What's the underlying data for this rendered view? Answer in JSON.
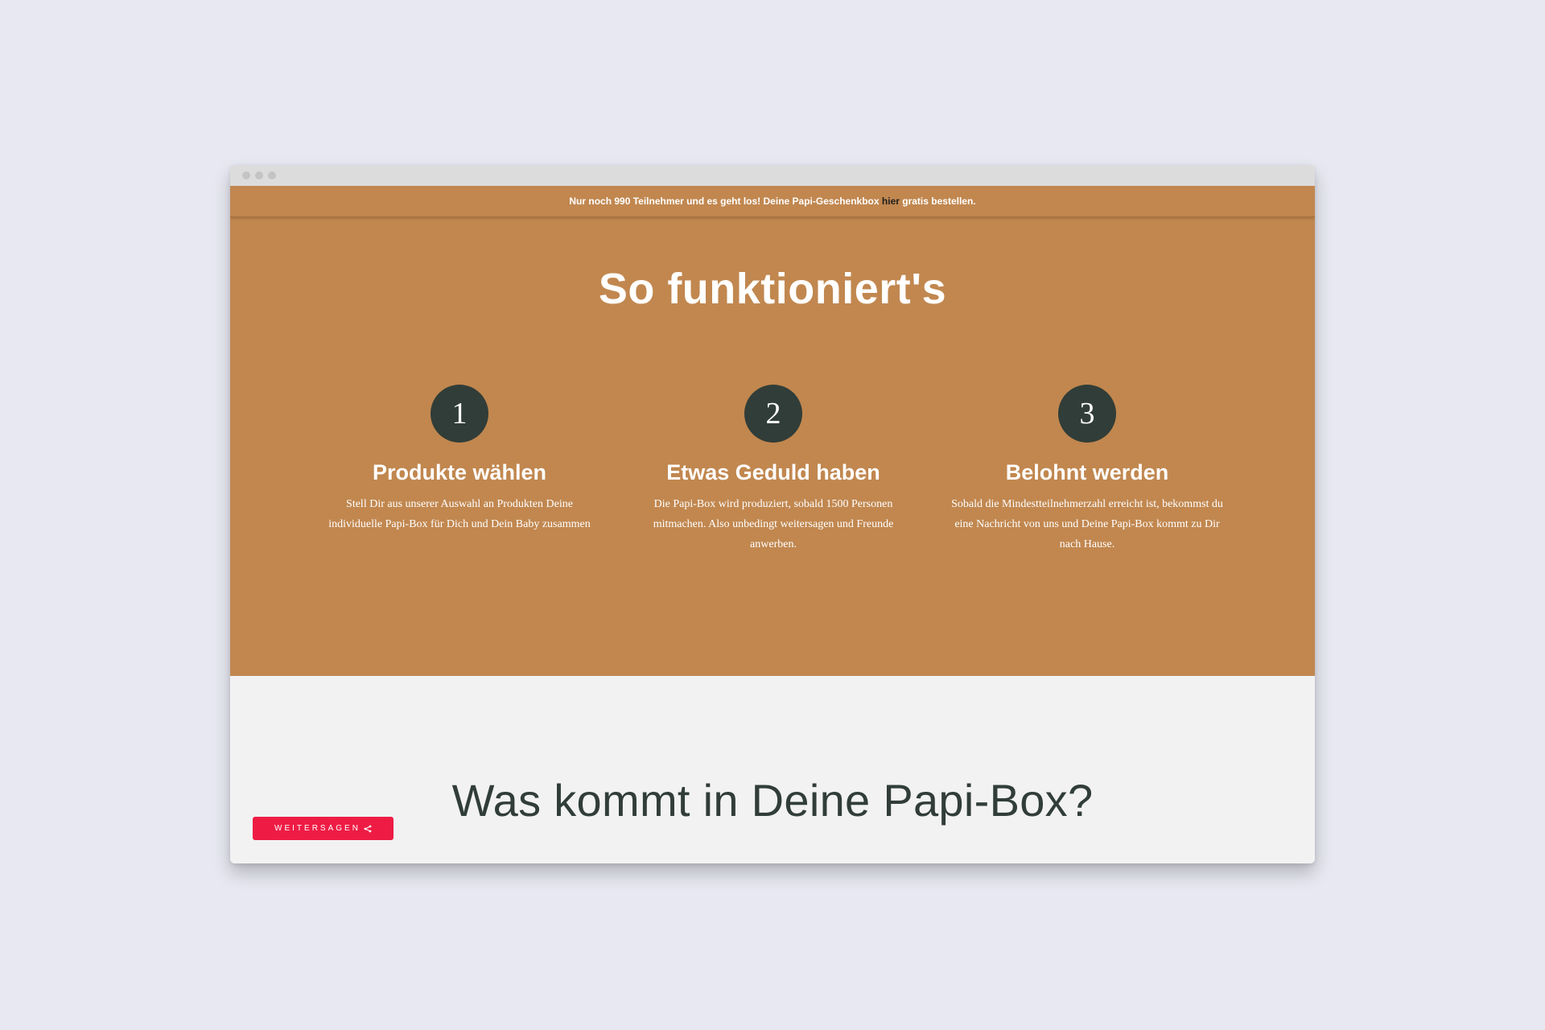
{
  "announcement": {
    "before": "Nur noch 990 Teilnehmer und es geht los! Deine Papi-Geschenkbox ",
    "link": "hier",
    "after": " gratis bestellen."
  },
  "how": {
    "title": "So funktioniert's",
    "steps": [
      {
        "number": "1",
        "title": "Produkte wählen",
        "text": "Stell Dir aus unserer Auswahl an Produkten Deine individuelle Papi-Box für Dich und Dein Baby zusammen"
      },
      {
        "number": "2",
        "title": "Etwas Geduld haben",
        "text": "Die Papi-Box wird produziert, sobald 1500 Personen mitmachen. Also unbedingt weitersagen und Freunde anwerben."
      },
      {
        "number": "3",
        "title": "Belohnt werden",
        "text": "Sobald die Mindestteilnehmerzahl erreicht ist, bekommst du eine Nachricht von uns und Deine Papi-Box kommt zu Dir nach Hause."
      }
    ]
  },
  "box": {
    "title": "Was kommt in Deine Papi-Box?"
  },
  "share": {
    "label": "WEITERSAGEN",
    "icon": "share-icon"
  },
  "colors": {
    "brand_brown": "#c1874f",
    "dark_green": "#313d38",
    "share_red": "#ee1c45"
  }
}
